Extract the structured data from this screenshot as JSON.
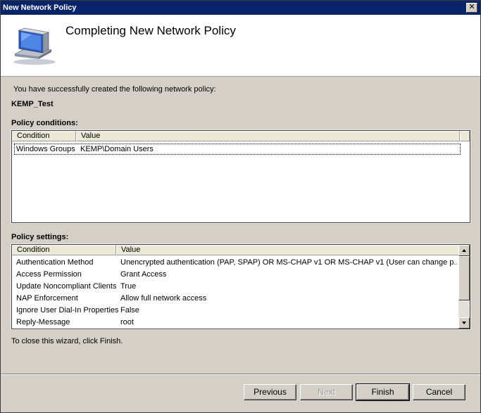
{
  "window": {
    "title": "New Network Policy"
  },
  "header": {
    "title": "Completing New Network Policy",
    "icon": "network-computer-icon"
  },
  "intro_text": "You have successfully created the following network policy:",
  "policy_name": "KEMP_Test",
  "conditions": {
    "label": "Policy conditions:",
    "columns": [
      "Condition",
      "Value"
    ],
    "rows": [
      {
        "condition": "Windows Groups",
        "value": "KEMP\\Domain Users"
      }
    ]
  },
  "settings": {
    "label": "Policy settings:",
    "columns": [
      "Condition",
      "Value"
    ],
    "rows": [
      {
        "condition": "Authentication Method",
        "value": "Unencrypted authentication (PAP, SPAP) OR MS-CHAP v1 OR MS-CHAP v1 (User can change p..."
      },
      {
        "condition": "Access Permission",
        "value": "Grant Access"
      },
      {
        "condition": "Update Noncompliant Clients",
        "value": "True"
      },
      {
        "condition": "NAP Enforcement",
        "value": "Allow full network access"
      },
      {
        "condition": "Ignore User Dial-In Properties",
        "value": "False"
      },
      {
        "condition": "Reply-Message",
        "value": "root"
      }
    ]
  },
  "footer_text": "To close this wizard, click Finish.",
  "buttons": {
    "previous": "Previous",
    "next": "Next",
    "finish": "Finish",
    "cancel": "Cancel"
  }
}
